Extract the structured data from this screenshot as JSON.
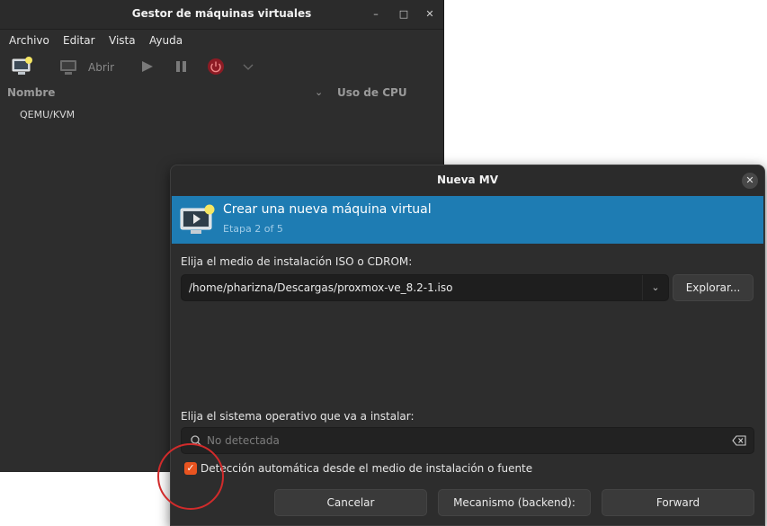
{
  "main_window": {
    "title": "Gestor de máquinas virtuales",
    "controls": {
      "minimize": "–",
      "maximize": "□",
      "close": "✕"
    },
    "menu": [
      "Archivo",
      "Editar",
      "Vista",
      "Ayuda"
    ],
    "toolbar": {
      "open_label": "Abrir"
    },
    "columns": {
      "name": "Nombre",
      "cpu": "Uso de CPU"
    },
    "connection": "QEMU/KVM"
  },
  "dialog": {
    "title": "Nueva MV",
    "close": "✕",
    "banner": {
      "title": "Crear una nueva máquina virtual",
      "step": "Etapa 2 of 5"
    },
    "media_label": "Elija el medio de instalación ISO o CDROM:",
    "media_path": "/home/pharizna/Descargas/proxmox-ve_8.2-1.iso",
    "browse_button": "Explorar...",
    "os_label": "Elija el sistema operativo que va a instalar:",
    "os_placeholder": "No detectada",
    "autodetect_label": "Detección automática desde el medio de instalación o fuente",
    "autodetect_checked": true,
    "buttons": {
      "cancel": "Cancelar",
      "backend": "Mecanismo (backend):",
      "forward": "Forward"
    }
  },
  "colors": {
    "accent": "#e95420",
    "banner": "#1e7cb3",
    "power": "#c7162b",
    "annotation": "#d12b2b"
  }
}
